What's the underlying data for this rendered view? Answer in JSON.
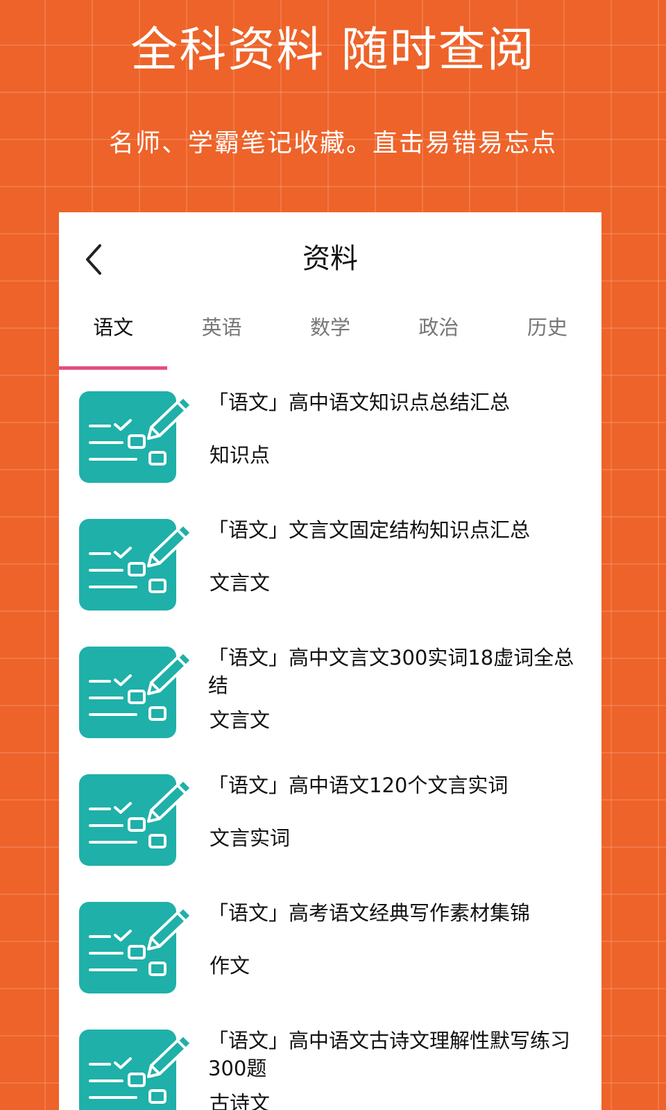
{
  "promo": {
    "headline": "全科资料 随时查阅",
    "subline": "名师、学霸笔记收藏。直击易错易忘点"
  },
  "header": {
    "title": "资料"
  },
  "tabs": [
    {
      "label": "语文",
      "active": true
    },
    {
      "label": "英语",
      "active": false
    },
    {
      "label": "数学",
      "active": false
    },
    {
      "label": "政治",
      "active": false
    },
    {
      "label": "历史",
      "active": false
    }
  ],
  "items": [
    {
      "title": "「语文」高中语文知识点总结汇总",
      "tag": "知识点",
      "icon": "checklist-pencil-icon"
    },
    {
      "title": "「语文」文言文固定结构知识点汇总",
      "tag": "文言文",
      "icon": "checklist-pencil-icon"
    },
    {
      "title": "「语文」高中文言文300实词18虚词全总结",
      "tag": "文言文",
      "icon": "checklist-pencil-icon"
    },
    {
      "title": "「语文」高中语文120个文言实词",
      "tag": "文言实词",
      "icon": "checklist-pencil-icon"
    },
    {
      "title": "「语文」高考语文经典写作素材集锦",
      "tag": "作文",
      "icon": "checklist-pencil-icon"
    },
    {
      "title": "「语文」高中语文古诗文理解性默写练习300题",
      "tag": "古诗文",
      "icon": "checklist-pencil-icon"
    }
  ],
  "colors": {
    "background": "#EE6329",
    "tab_indicator": "#E94D7C",
    "thumbnail": "#1FB0A9"
  }
}
